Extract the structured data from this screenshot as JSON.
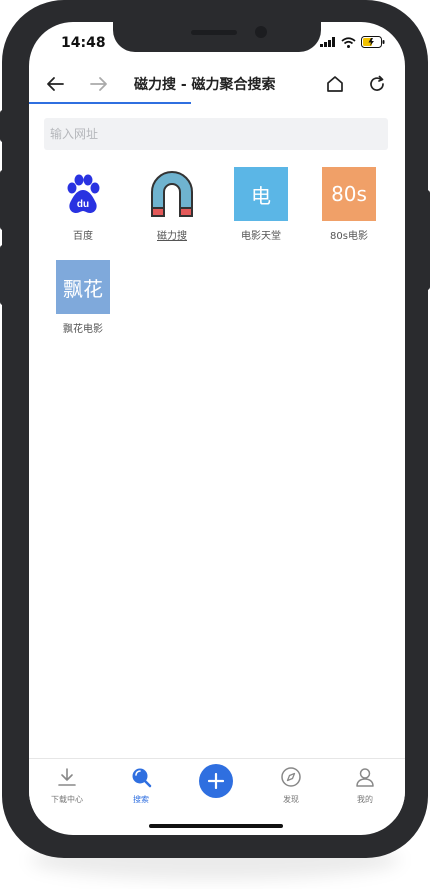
{
  "status": {
    "time": "14:48"
  },
  "nav": {
    "title": "磁力搜 - 磁力聚合搜索",
    "back_icon": "arrow-left-icon",
    "forward_icon": "arrow-right-icon",
    "home_icon": "home-icon",
    "refresh_icon": "refresh-icon",
    "progress_percent": 43
  },
  "search": {
    "placeholder": "输入网址",
    "value": ""
  },
  "sites": [
    {
      "label": "百度",
      "icon": "baidu-paw-icon",
      "color": "#2932e1"
    },
    {
      "label": "磁力搜",
      "icon": "magnet-icon",
      "color": "#5aa8c8",
      "underline": true
    },
    {
      "label": "电影天堂",
      "tile_text": "电",
      "color": "#5bb6e6"
    },
    {
      "label": "80s电影",
      "tile_text": "80s",
      "color": "#f0a068"
    },
    {
      "label": "飘花电影",
      "tile_text": "飘花",
      "color": "#7fa9db"
    }
  ],
  "tabbar": {
    "items": [
      {
        "label": "下载中心",
        "icon": "download-icon"
      },
      {
        "label": "搜索",
        "icon": "search-icon",
        "active": true
      },
      {
        "label": "",
        "icon": "plus-icon"
      },
      {
        "label": "发现",
        "icon": "compass-icon"
      },
      {
        "label": "我的",
        "icon": "user-icon"
      }
    ]
  },
  "colors": {
    "accent": "#2f6fe0",
    "frame": "#2a2b2e"
  }
}
